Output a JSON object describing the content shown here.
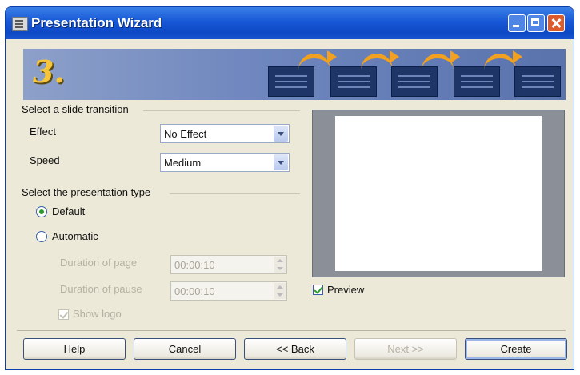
{
  "window": {
    "title": "Presentation Wizard"
  },
  "banner": {
    "step_number": "3."
  },
  "transition": {
    "group_label": "Select a slide transition",
    "effect_label": "Effect",
    "effect_value": "No Effect",
    "speed_label": "Speed",
    "speed_value": "Medium"
  },
  "presentation_type": {
    "group_label": "Select the presentation type",
    "default_label": "Default",
    "automatic_label": "Automatic",
    "selected": "Default",
    "duration_page_label": "Duration of page",
    "duration_page_value": "00:00:10",
    "duration_pause_label": "Duration of pause",
    "duration_pause_value": "00:00:10",
    "show_logo_label": "Show logo"
  },
  "preview": {
    "checkbox_label": "Preview",
    "checked": true
  },
  "buttons": {
    "help": "Help",
    "cancel": "Cancel",
    "back": "<< Back",
    "next": "Next >>",
    "create": "Create"
  },
  "icons": [
    "window-app-icon",
    "minimize-icon",
    "maximize-icon",
    "close-icon",
    "dropdown-arrow-icon",
    "spin-arrows-icon"
  ],
  "colors": {
    "titlebar": "#1757d6",
    "dialog_bg": "#ece9d8",
    "banner": "#7088bf",
    "step_number": "#f6c63a",
    "arrows": "#f2a020",
    "close_button": "#dd5a2c"
  }
}
